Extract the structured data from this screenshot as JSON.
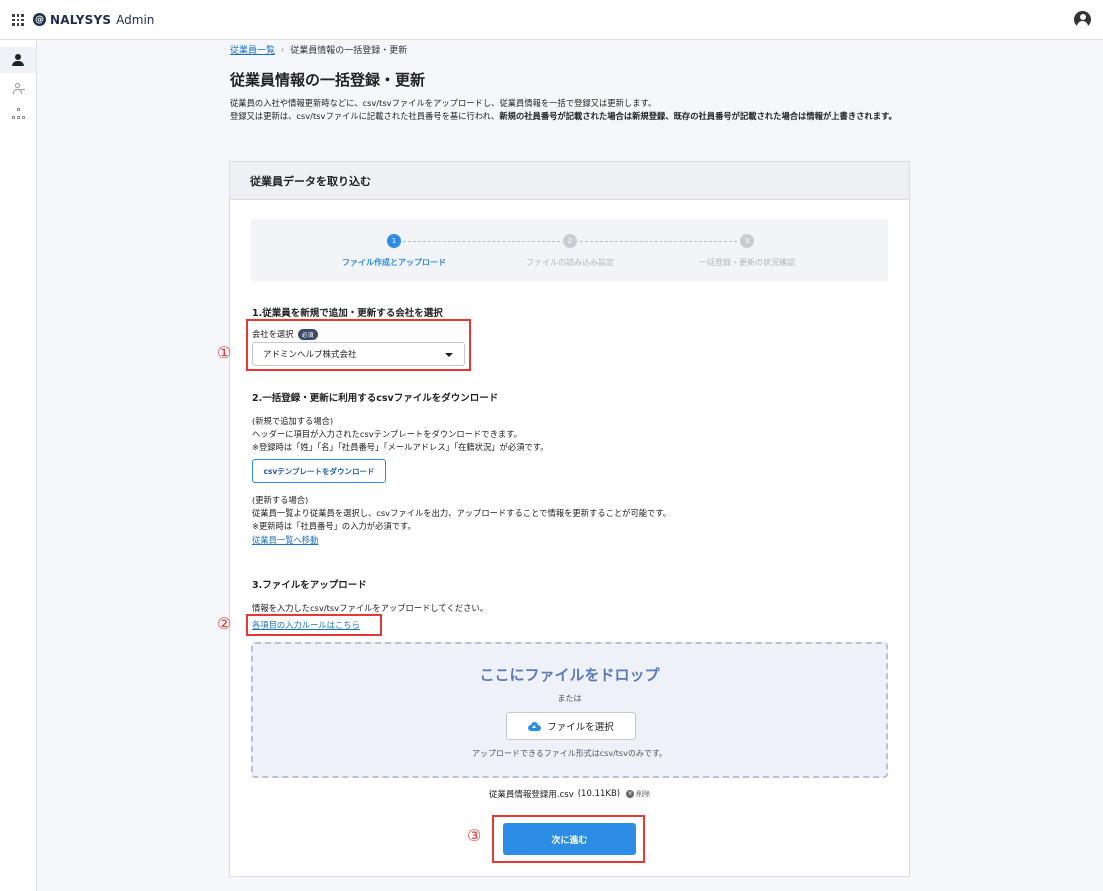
{
  "app": {
    "brand": "NALYSYS",
    "suffix": "Admin",
    "logo_glyph": "@"
  },
  "sidebar": {
    "items": [
      "person-icon",
      "users-icon",
      "org-chart-icon"
    ]
  },
  "breadcrumb": {
    "link": "従業員一覧",
    "separator": "›",
    "current": "従業員情報の一括登録・更新"
  },
  "page": {
    "title": "従業員情報の一括登録・更新",
    "desc_line1": "従業員の入社や情報更新時などに、csv/tsvファイルをアップロードし、従業員情報を一括で登録又は更新します。",
    "desc_line2_prefix": "登録又は更新は、csv/tsvファイルに記載された社員番号を基に行われ、",
    "desc_line2_bold": "新規の社員番号が記載された場合は新規登録、既存の社員番号が記載された場合は情報が上書きされます。"
  },
  "card": {
    "title": "従業員データを取り込む"
  },
  "stepper": {
    "steps": [
      {
        "num": "1",
        "label": "ファイル作成とアップロード",
        "state": "active"
      },
      {
        "num": "2",
        "label": "ファイルの読み込み設定",
        "state": "inactive"
      },
      {
        "num": "3",
        "label": "一括登録・更新の状況確認",
        "state": "inactive"
      }
    ]
  },
  "section1": {
    "title": "1.従業員を新規で追加・更新する会社を選択",
    "field_label": "会社を選択",
    "required_badge": "必須",
    "selected_company": "アドミンヘルプ株式会社"
  },
  "section2": {
    "title": "2.一括登録・更新に利用するcsvファイルをダウンロード",
    "new_heading": "(新規で追加する場合)",
    "new_line1": "ヘッダーに項目が入力されたcsvテンプレートをダウンロードできます。",
    "new_line2": "※登録時は「姓」「名」「社員番号」「メールアドレス」「在籍状況」が必須です。",
    "template_button": "csvテンプレートをダウンロード",
    "update_heading": "(更新する場合)",
    "update_line1": "従業員一覧より従業員を選択し、csvファイルを出力、アップロードすることで情報を更新することが可能です。",
    "update_line2": "※更新時は「社員番号」の入力が必須です。",
    "link": "従業員一覧へ移動"
  },
  "section3": {
    "title": "3.ファイルをアップロード",
    "text": "情報を入力したcsv/tsvファイルをアップロードしてください。",
    "rules_link": "各項目の入力ルールはこちら",
    "drop_title": "ここにファイルをドロップ",
    "or": "または",
    "choose_button": "ファイルを選択",
    "note": "アップロードできるファイル形式はcsv/tsvのみです。",
    "file_name": "従業員情報登録用.csv",
    "file_size": "(10.11KB)",
    "delete_label": "削除"
  },
  "next_button": "次に進む",
  "annotations": {
    "a1": "①",
    "a2": "②",
    "a3": "③"
  },
  "colors": {
    "accent": "#2d8de6",
    "annotation": "#e53935",
    "brand": "#1f2d4e"
  }
}
